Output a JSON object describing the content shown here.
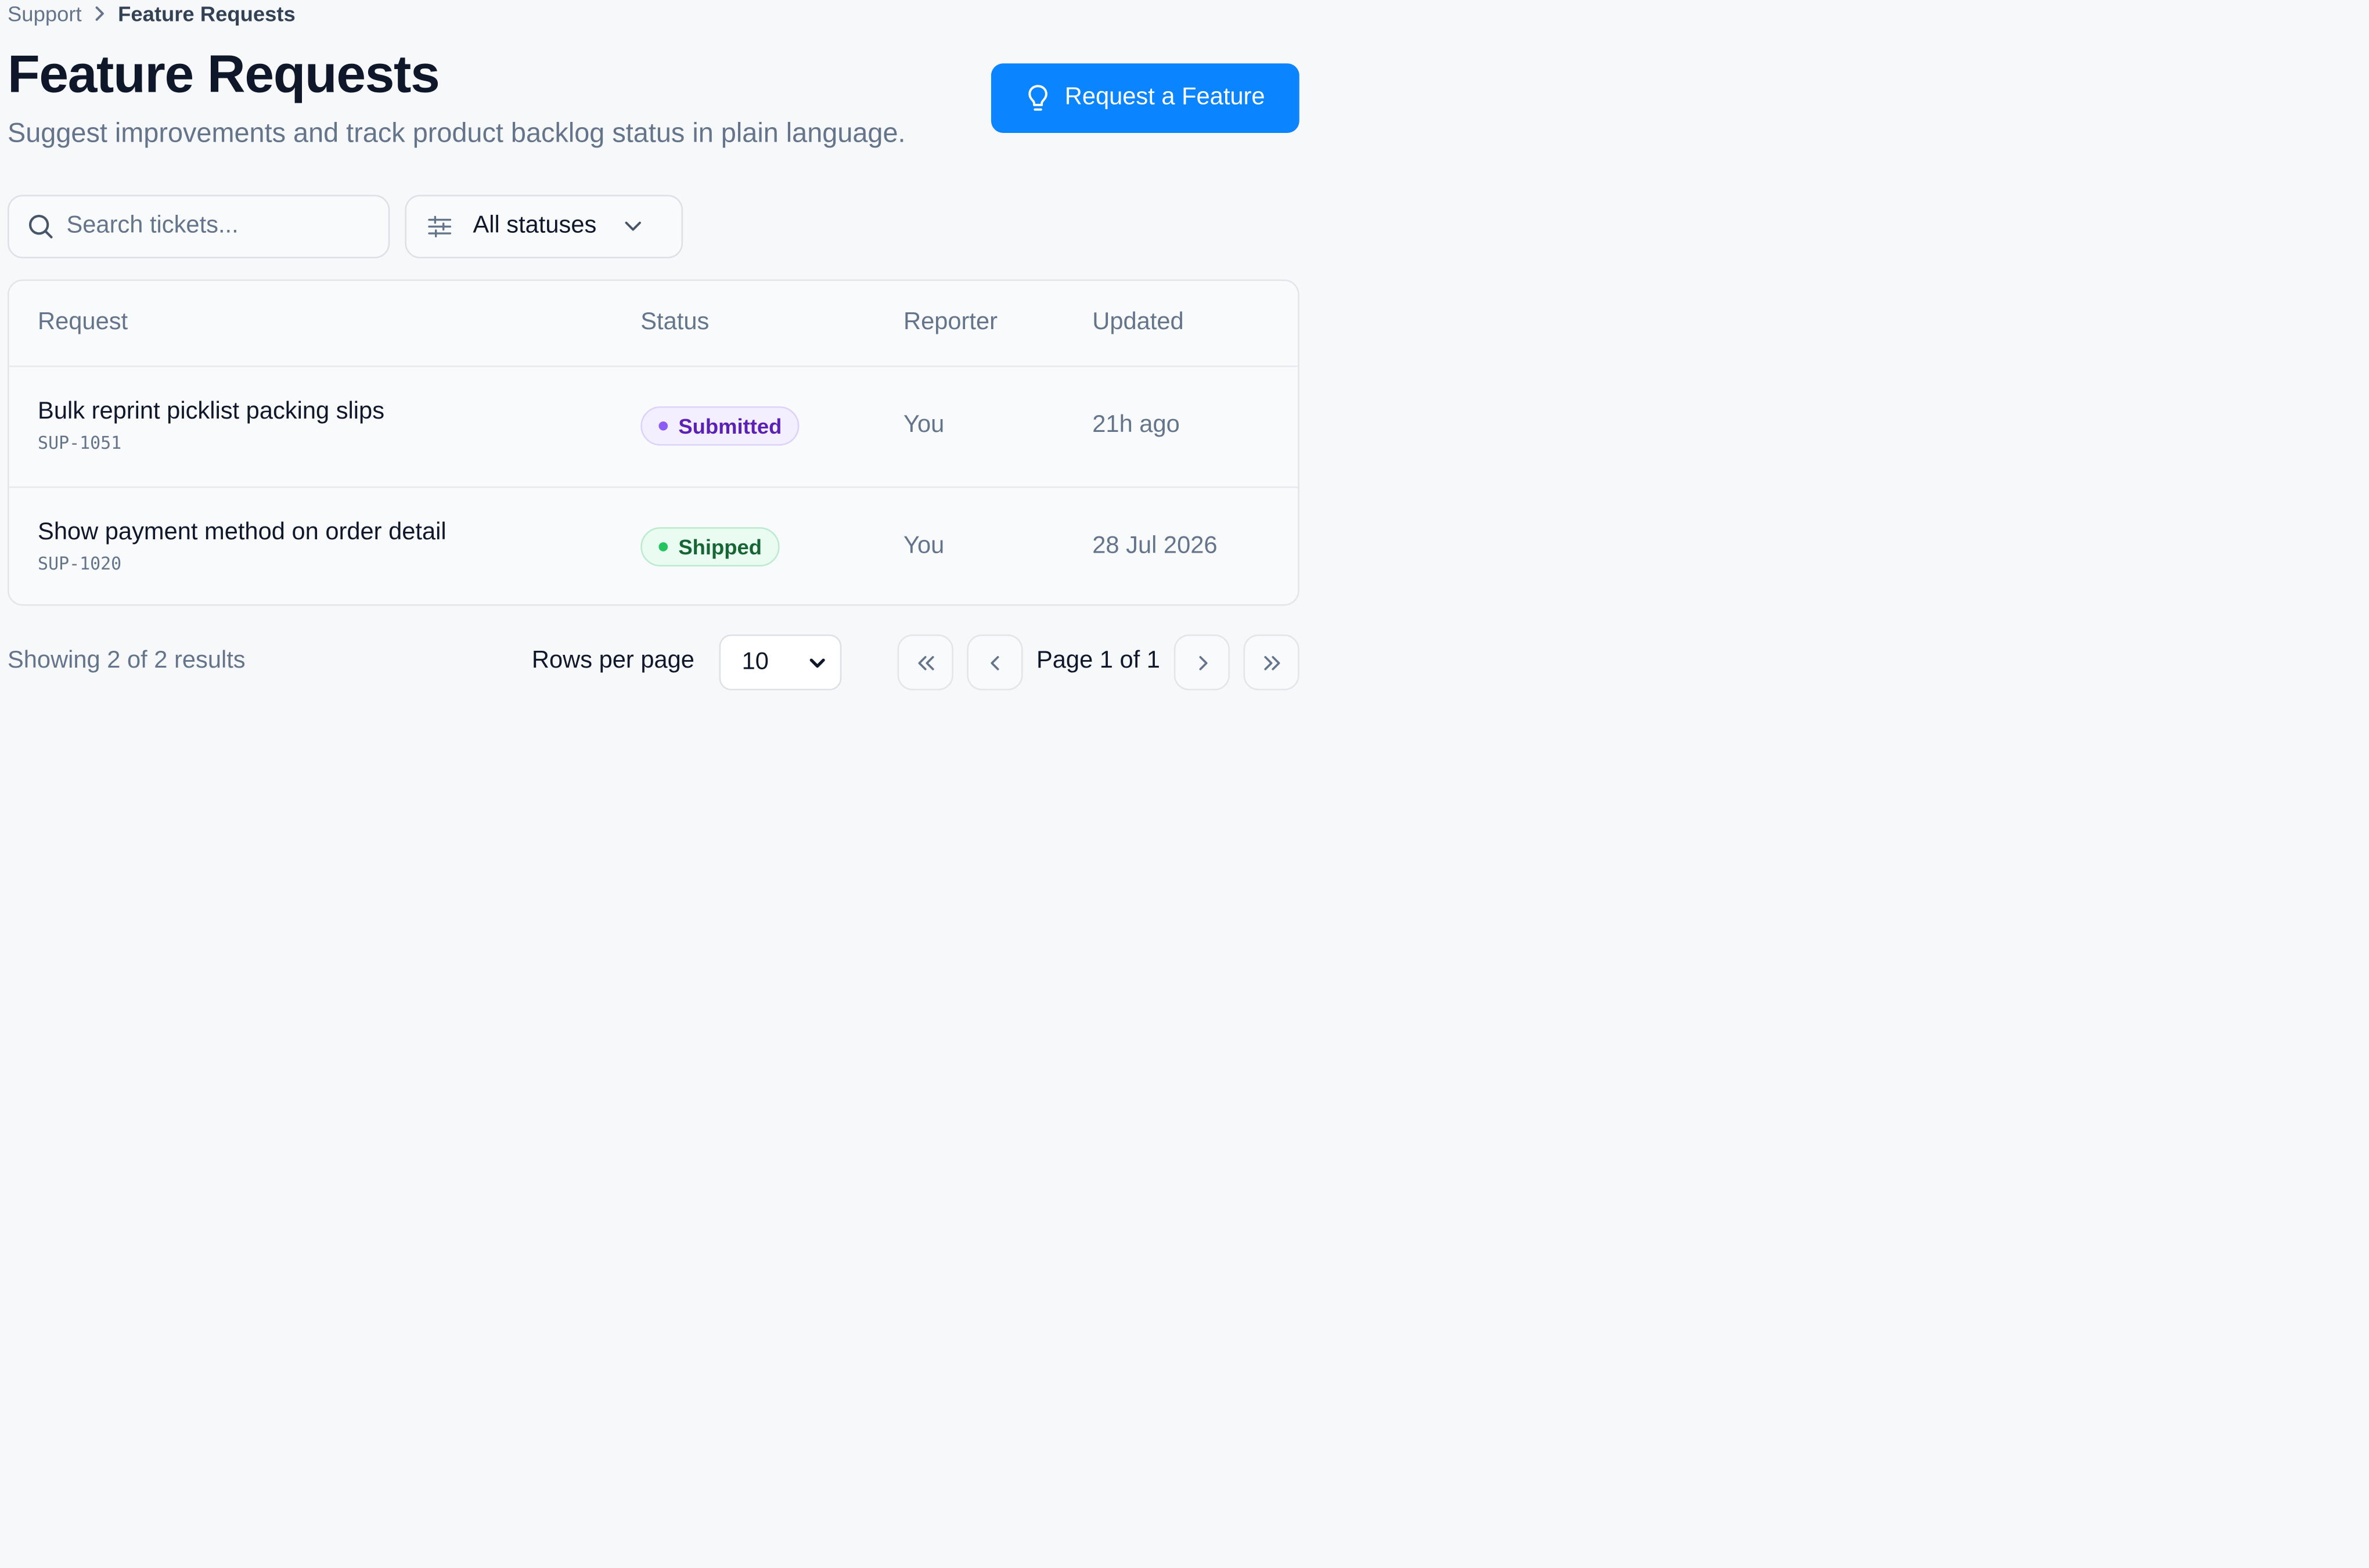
{
  "breadcrumb": {
    "parent": "Support",
    "current": "Feature Requests"
  },
  "header": {
    "title": "Feature Requests",
    "subtitle": "Suggest improvements and track product backlog status in plain language.",
    "primary_action": {
      "label": "Request a Feature",
      "icon": "lightbulb-icon"
    }
  },
  "filters": {
    "search_placeholder": "Search tickets...",
    "status_filter": "All statuses"
  },
  "table": {
    "columns": [
      "Request",
      "Status",
      "Reporter",
      "Updated"
    ],
    "rows": [
      {
        "title": "Bulk reprint picklist packing slips",
        "id": "SUP-1051",
        "status": "Submitted",
        "reporter": "You",
        "updated": "21h ago"
      },
      {
        "title": "Show payment method on order detail",
        "id": "SUP-1020",
        "status": "Shipped",
        "reporter": "You",
        "updated": "28 Jul 2026"
      }
    ]
  },
  "footer": {
    "summary": "Showing 2 of 2 results",
    "rows_per_page_label": "Rows per page",
    "rows_per_page_value": "10",
    "page_label": "Page 1 of 1"
  },
  "colors": {
    "accent": "#0a84ff",
    "background": "#f7f8fa",
    "submitted": "#8b5cf6",
    "shipped": "#22c55e"
  }
}
